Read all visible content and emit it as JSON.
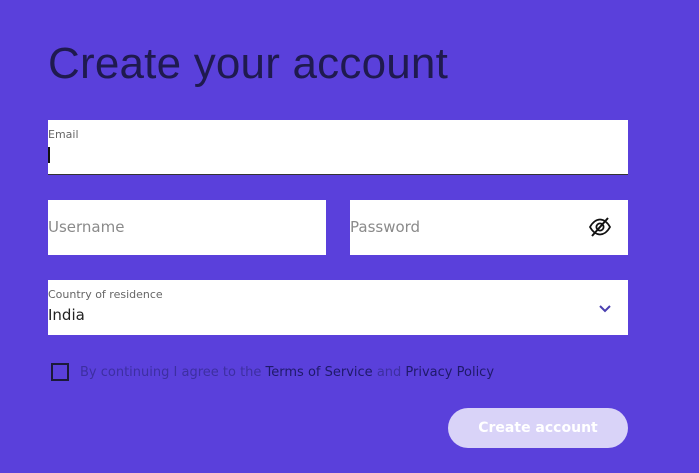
{
  "page": {
    "title": "Create your account"
  },
  "form": {
    "email": {
      "label": "Email",
      "value": ""
    },
    "username": {
      "placeholder": "Username"
    },
    "password": {
      "placeholder": "Password",
      "toggle_icon": "eye-slash-icon"
    },
    "country": {
      "label": "Country of residence",
      "value": "India",
      "dropdown_icon": "chevron-down-icon"
    },
    "consent": {
      "prefix": "By continuing I agree to the",
      "terms_link": "Terms of Service",
      "connector": "and",
      "privacy_link": "Privacy Policy"
    },
    "submit_label": "Create account"
  },
  "colors": {
    "background": "#5a40db",
    "title": "#1f1a4f",
    "field_bg": "#ffffff",
    "button_bg": "#d9d3f8",
    "button_text": "#ffffff"
  }
}
